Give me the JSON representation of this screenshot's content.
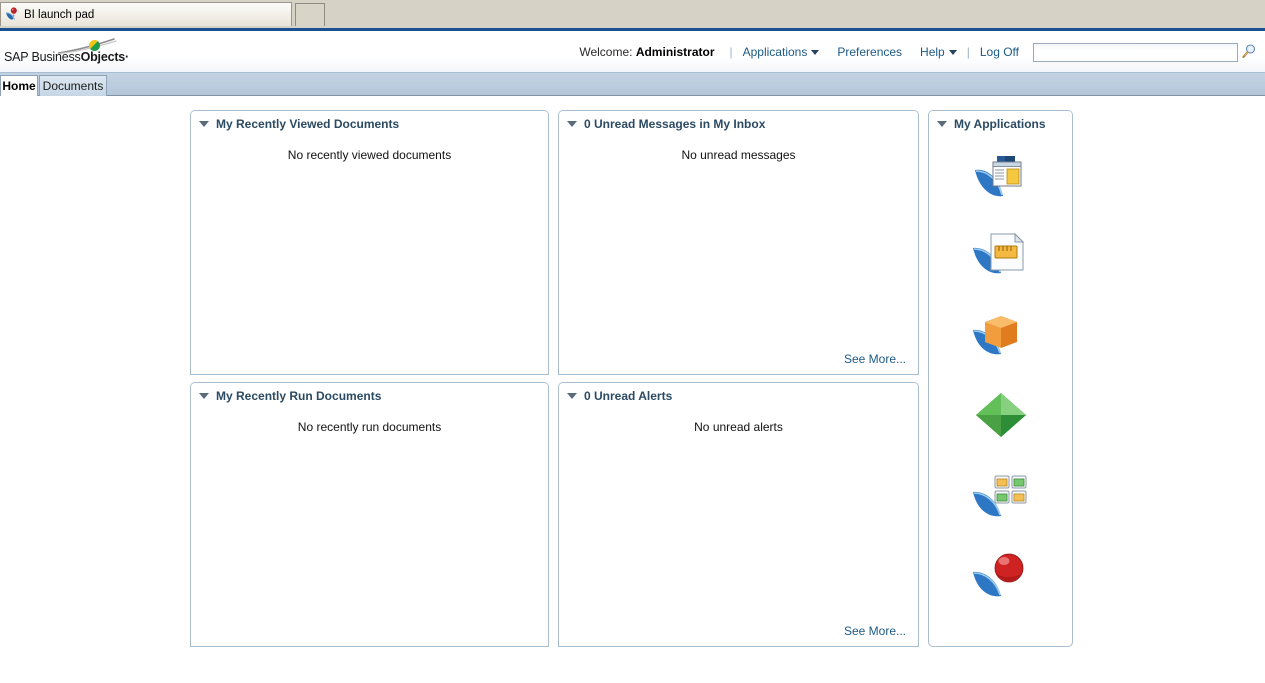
{
  "browser": {
    "tab_title": "BI launch pad",
    "favicon_name": "sap-swoosh-favicon"
  },
  "header": {
    "logo_line1": "SAP Business",
    "logo_line2": "Objects",
    "welcome_label": "Welcome:",
    "user_name": "Administrator",
    "nav": [
      {
        "label": "Applications",
        "has_caret": true
      },
      {
        "label": "Preferences",
        "has_caret": false
      },
      {
        "label": "Help",
        "has_caret": true
      },
      {
        "label": "Log Off",
        "has_caret": false
      }
    ],
    "search": {
      "value": "",
      "placeholder": ""
    },
    "search_icon": "magnifier-icon"
  },
  "tabs": [
    {
      "label": "Home",
      "active": true
    },
    {
      "label": "Documents",
      "active": false
    }
  ],
  "panels": {
    "recently_viewed": {
      "title": "My Recently Viewed Documents",
      "empty_message": "No recently viewed documents"
    },
    "inbox": {
      "title": "0 Unread Messages in My Inbox",
      "empty_message": "No unread messages",
      "see_more": "See More..."
    },
    "recently_run": {
      "title": "My Recently Run Documents",
      "empty_message": "No recently run documents"
    },
    "alerts": {
      "title": "0 Unread Alerts",
      "empty_message": "No unread alerts",
      "see_more": "See More..."
    },
    "applications": {
      "title": "My Applications",
      "icons": [
        {
          "name": "bi-workspace-icon"
        },
        {
          "name": "web-intelligence-icon"
        },
        {
          "name": "universe-designer-icon"
        },
        {
          "name": "analysis-edition-olap-icon"
        },
        {
          "name": "dashboards-icon"
        },
        {
          "name": "explorer-icon"
        }
      ]
    }
  },
  "colors": {
    "accent_blue": "#1d4e8f",
    "link_blue": "#1c5a86",
    "panel_border": "#a9bdd0",
    "tabbar_bg": "#b4c7da",
    "header_title": "#2b4a63"
  }
}
